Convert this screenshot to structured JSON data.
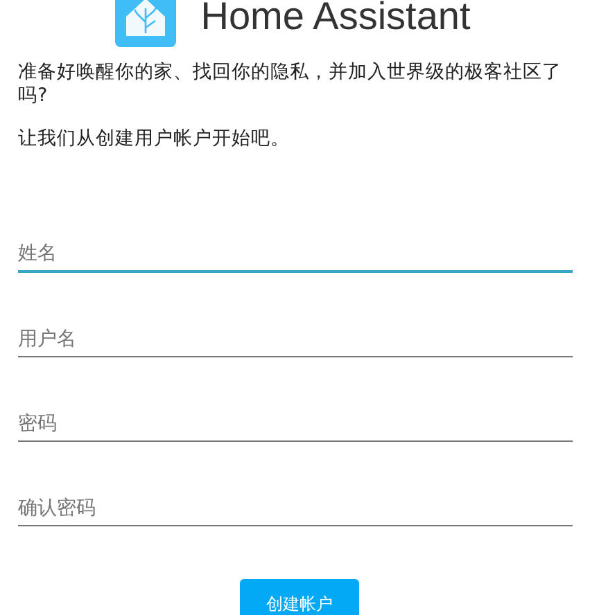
{
  "header": {
    "title": "Home Assistant"
  },
  "intro": [
    "准备好唤醒你的家、找回你的隐私，并加入世界级的极客社区了吗?",
    "让我们从创建用户帐户开始吧。"
  ],
  "fields": [
    {
      "placeholder": "姓名",
      "focused": true
    },
    {
      "placeholder": "用户名",
      "focused": false
    },
    {
      "placeholder": "密码",
      "focused": false
    },
    {
      "placeholder": "确认密码",
      "focused": false
    }
  ],
  "submit": {
    "label": "创建帐户"
  }
}
